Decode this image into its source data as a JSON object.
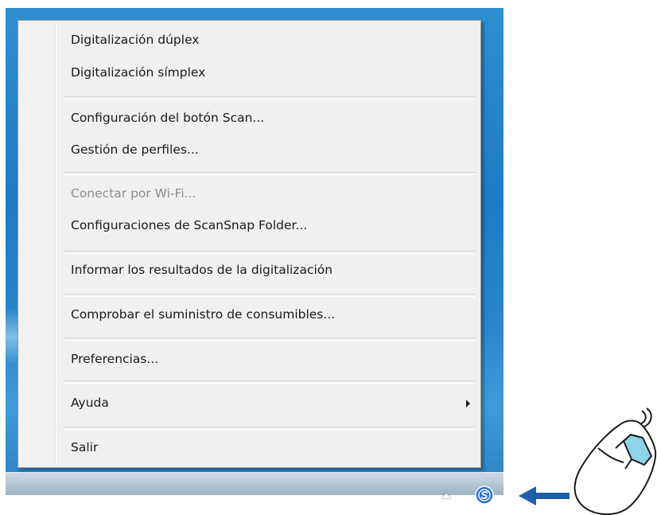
{
  "menu": {
    "items": [
      {
        "label": "Digitalización dúplex",
        "enabled": true
      },
      {
        "label": "Digitalización símplex",
        "enabled": true
      },
      {
        "label": "Configuración del botón Scan...",
        "enabled": true
      },
      {
        "label": "Gestión de perfiles...",
        "enabled": true
      },
      {
        "label": "Conectar por Wi-Fi...",
        "enabled": false
      },
      {
        "label": "Configuraciones de ScanSnap Folder...",
        "enabled": true
      },
      {
        "label": "Informar los resultados de la digitalización",
        "enabled": true
      },
      {
        "label": "Comprobar el suministro de consumibles...",
        "enabled": true
      },
      {
        "label": "Preferencias...",
        "enabled": true
      },
      {
        "label": "Ayuda",
        "enabled": true,
        "has_submenu": true
      },
      {
        "label": "Salir",
        "enabled": true
      }
    ]
  },
  "tray": {
    "show_hidden_icon": "chevron-up-icon",
    "app_icon": "scansnap-manager-icon",
    "app_icon_color": "#2a6fd0"
  },
  "callout": {
    "arrow_icon": "left-arrow-icon",
    "arrow_color": "#1f5fa8",
    "mouse_icon": "mouse-right-click-icon",
    "mouse_button_color": "#8fd3e8"
  },
  "colors": {
    "desktop": "#2a86cb",
    "menu_background": "#f0f0f0",
    "disabled_text": "#8d8d8d"
  }
}
